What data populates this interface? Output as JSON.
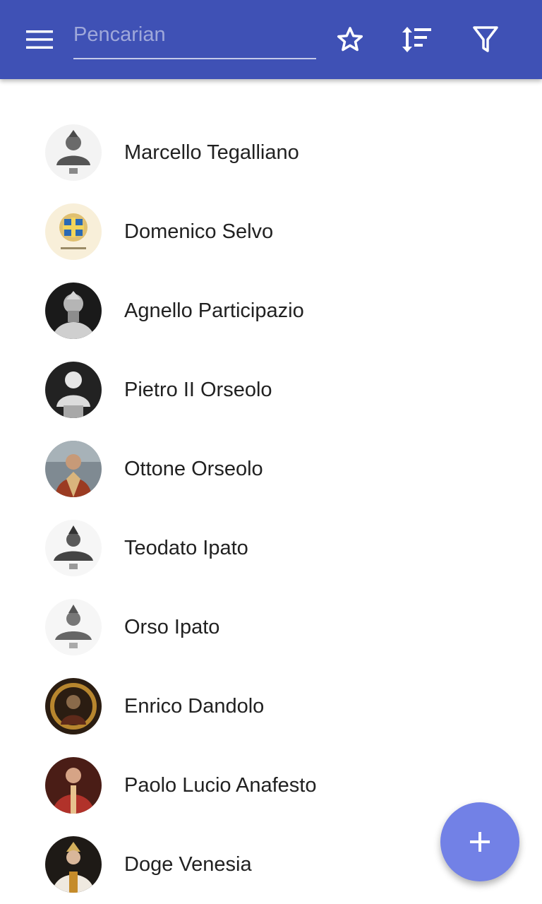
{
  "toolbar": {
    "menu_icon": "hamburger-icon",
    "search_placeholder": "Pencarian",
    "search_value": "",
    "favorite_icon": "star-outline-icon",
    "sort_icon": "sort-icon",
    "filter_icon": "filter-icon",
    "background_color": "#3F51B5"
  },
  "list": {
    "items": [
      {
        "name": "Marcello Tegalliano"
      },
      {
        "name": "Domenico Selvo"
      },
      {
        "name": "Agnello Participazio"
      },
      {
        "name": "Pietro II Orseolo"
      },
      {
        "name": "Ottone Orseolo"
      },
      {
        "name": "Teodato Ipato"
      },
      {
        "name": "Orso Ipato"
      },
      {
        "name": "Enrico Dandolo"
      },
      {
        "name": "Paolo Lucio Anafesto"
      },
      {
        "name": "Doge Venesia"
      }
    ]
  },
  "fab": {
    "icon": "plus-icon",
    "color": "#7281E6"
  }
}
